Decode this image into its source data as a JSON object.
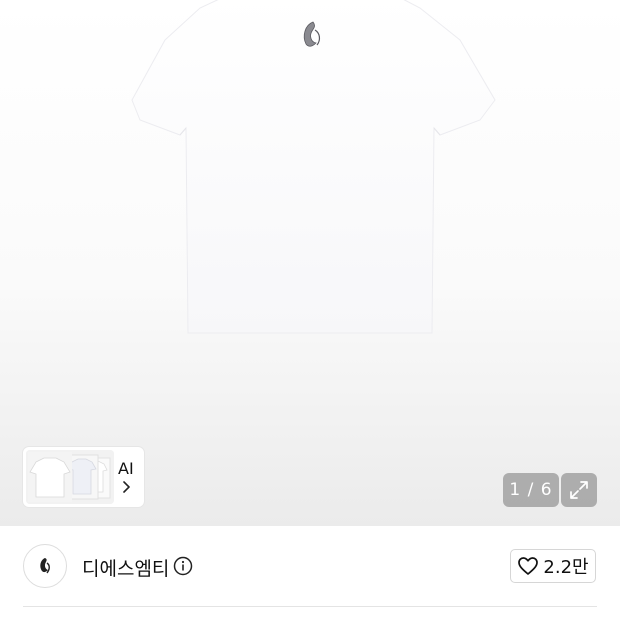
{
  "gallery": {
    "image_alt": "white t-shirt",
    "ai_label": "AI",
    "counter": "1 / 6",
    "expand_icon": "expand-icon"
  },
  "brand": {
    "name": "디에스엠티",
    "info_icon": "info-icon",
    "logo_icon": "brand-logo-icon"
  },
  "wishlist": {
    "count": "2.2만",
    "icon": "heart-icon"
  }
}
